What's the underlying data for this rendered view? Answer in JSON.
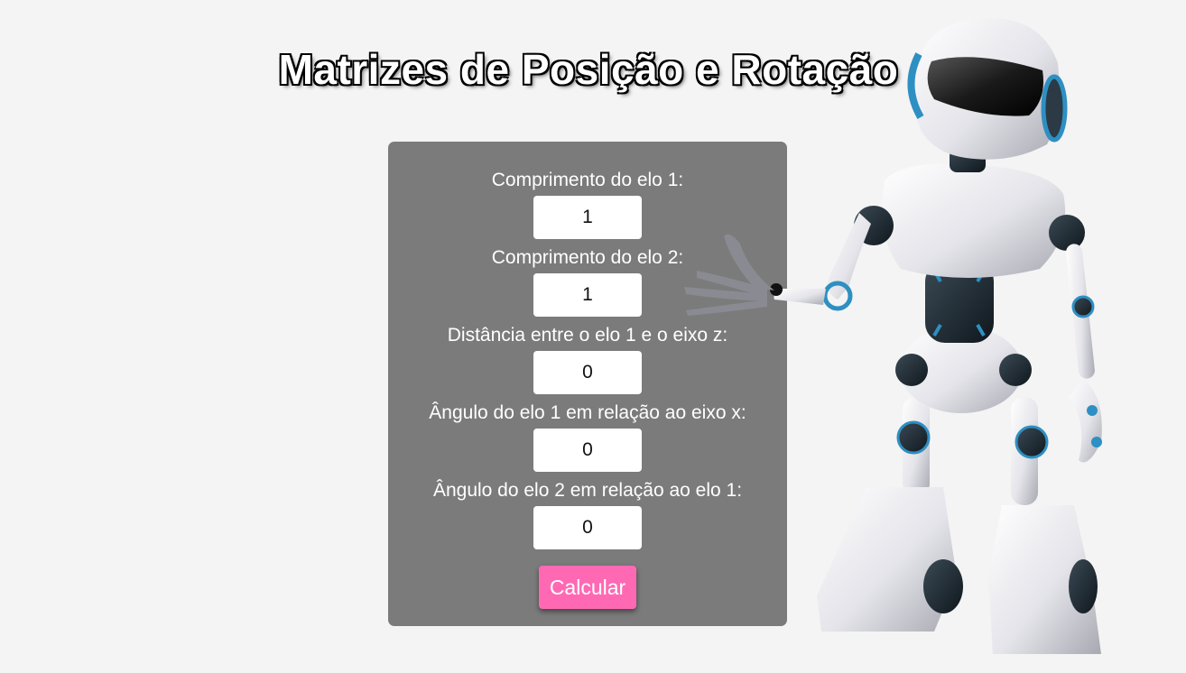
{
  "page": {
    "title": "Matrizes de Posição e Rotação"
  },
  "form": {
    "fields": [
      {
        "label": "Comprimento do elo 1:",
        "value": "1"
      },
      {
        "label": "Comprimento do elo 2:",
        "value": "1"
      },
      {
        "label": "Distância entre o elo 1 e o eixo z:",
        "value": "0"
      },
      {
        "label": "Ângulo do elo 1 em relação ao eixo x:",
        "value": "0"
      },
      {
        "label": "Ângulo do elo 2 em relação ao elo 1:",
        "value": "0"
      }
    ],
    "submit_label": "Calcular"
  },
  "colors": {
    "background": "#f4f4f4",
    "panel": "#7b7b7b",
    "button": "#ff69b4",
    "robot_accent": "#2e8fc2"
  },
  "icons": {
    "robot": "robot-illustration"
  }
}
